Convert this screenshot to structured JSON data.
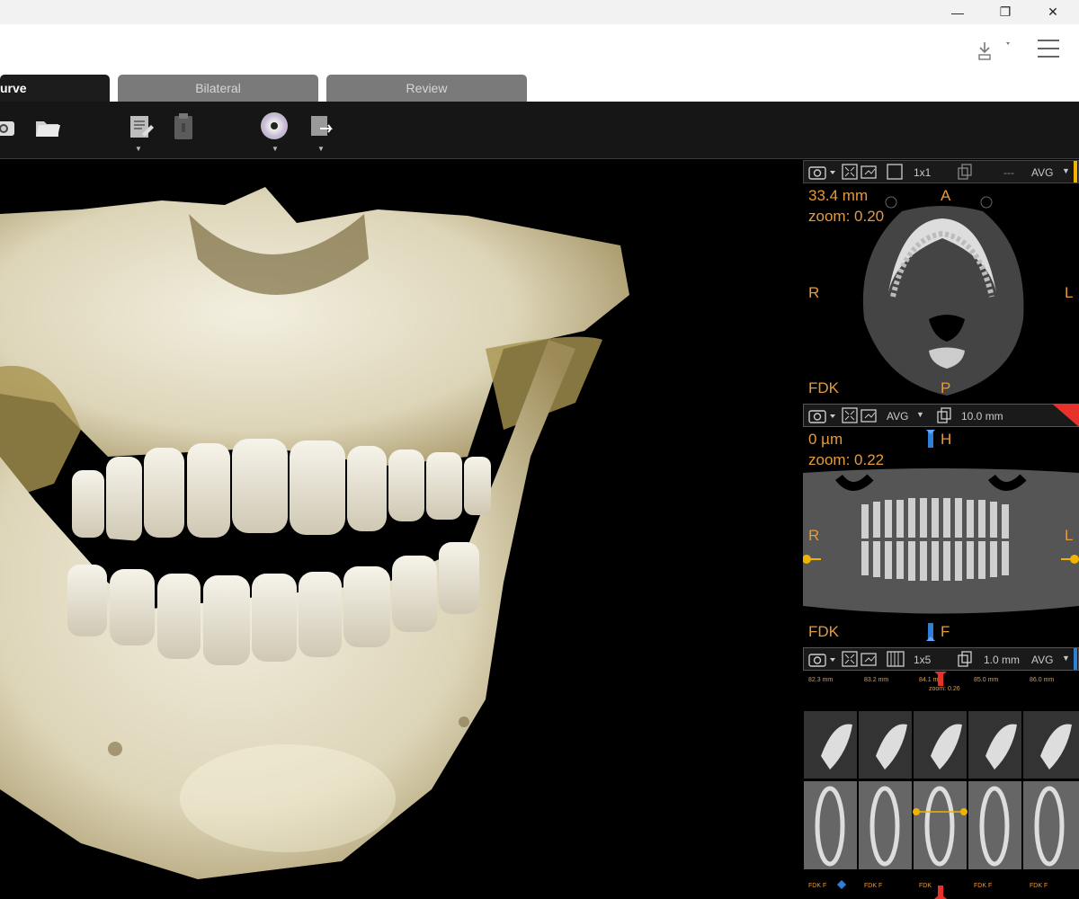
{
  "window": {
    "minimize_glyph": "—",
    "maximize_glyph": "❐",
    "close_glyph": "✕"
  },
  "tabs": [
    {
      "label": "urve"
    },
    {
      "label": "Bilateral"
    },
    {
      "label": "Review"
    }
  ],
  "toolbar": {
    "icons": [
      "camera-icon",
      "folder-icon",
      "report-icon",
      "clipboard-icon",
      "disc-icon",
      "export-icon"
    ]
  },
  "axial_panel": {
    "toolbar": {
      "layout": "1x1",
      "dash": "---",
      "mode": "AVG"
    },
    "thickness": "33.4 mm",
    "zoom": "zoom: 0.20",
    "label_top": "A",
    "label_bottom": "P",
    "label_left": "R",
    "label_right": "L",
    "algorithm": "FDK"
  },
  "panoramic_panel": {
    "toolbar": {
      "mode": "AVG",
      "slab": "10.0 mm"
    },
    "offset": "0 µm",
    "zoom": "zoom: 0.22",
    "label_marker": "H",
    "label_left": "R",
    "label_right": "L",
    "algorithm": "FDK",
    "label_bottom_marker": "F"
  },
  "cross_panel": {
    "toolbar": {
      "layout": "1x5",
      "slab": "1.0 mm",
      "mode": "AVG"
    },
    "slice_labels": [
      "82.3 mm",
      "83.2 mm",
      "84.1 mm",
      "85.0 mm",
      "86.0 mm"
    ],
    "active_zoom": "zoom: 0.26",
    "bottom_labels": [
      "FDK  F",
      "FDK  F",
      "FDK",
      "FDK  F",
      "FDK  F"
    ]
  },
  "colors": {
    "accent_orange": "#e59a3c",
    "marker_blue": "#2f7fd6",
    "marker_red": "#e8312a",
    "marker_yellow": "#f0b400"
  }
}
